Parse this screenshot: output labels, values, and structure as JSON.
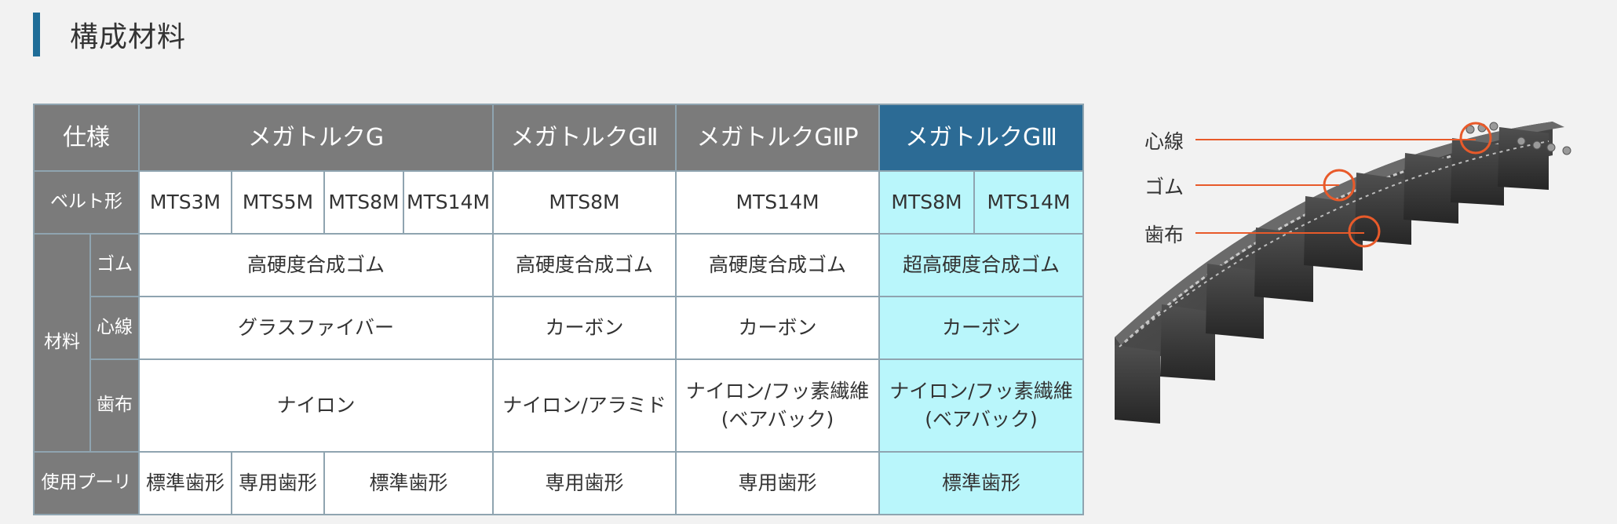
{
  "section": {
    "title": "構成材料"
  },
  "table": {
    "spec_label": "仕様",
    "products": {
      "g": "メガトルクG",
      "g2": "メガトルクGⅡ",
      "g2p": "メガトルクGⅡP",
      "g3": "メガトルクGⅢ"
    },
    "belt_type": {
      "label": "ベルト形",
      "g_mts3m": "MTS3M",
      "g_mts5m": "MTS5M",
      "g_mts8m": "MTS8M",
      "g_mts14m": "MTS14M",
      "g2": "MTS8M",
      "g2p": "MTS14M",
      "g3_mts8m": "MTS8M",
      "g3_mts14m": "MTS14M"
    },
    "material": {
      "label": "材料",
      "rubber": {
        "label": "ゴム",
        "g": "高硬度合成ゴム",
        "g2": "高硬度合成ゴム",
        "g2p": "高硬度合成ゴム",
        "g3": "超高硬度合成ゴム"
      },
      "core": {
        "label": "心線",
        "g": "グラスファイバー",
        "g2": "カーボン",
        "g2p": "カーボン",
        "g3": "カーボン"
      },
      "fabric": {
        "label": "歯布",
        "g": "ナイロン",
        "g2": "ナイロン/アラミド",
        "g2p_line1": "ナイロン/フッ素繊維",
        "g2p_line2": "(ベアバック)",
        "g3_line1": "ナイロン/フッ素繊維",
        "g3_line2": "(ベアバック)"
      }
    },
    "pulley": {
      "label": "使用プーリ",
      "g_mts3m": "標準歯形",
      "g_mts5m": "専用歯形",
      "g_rest": "標準歯形",
      "g2": "専用歯形",
      "g2p": "専用歯形",
      "g3": "標準歯形"
    }
  },
  "diagram": {
    "labels": {
      "core": "心線",
      "rubber": "ゴム",
      "fabric": "歯布"
    },
    "colors": {
      "callout": "#e85a2a",
      "belt": "#3a3a3a"
    }
  }
}
